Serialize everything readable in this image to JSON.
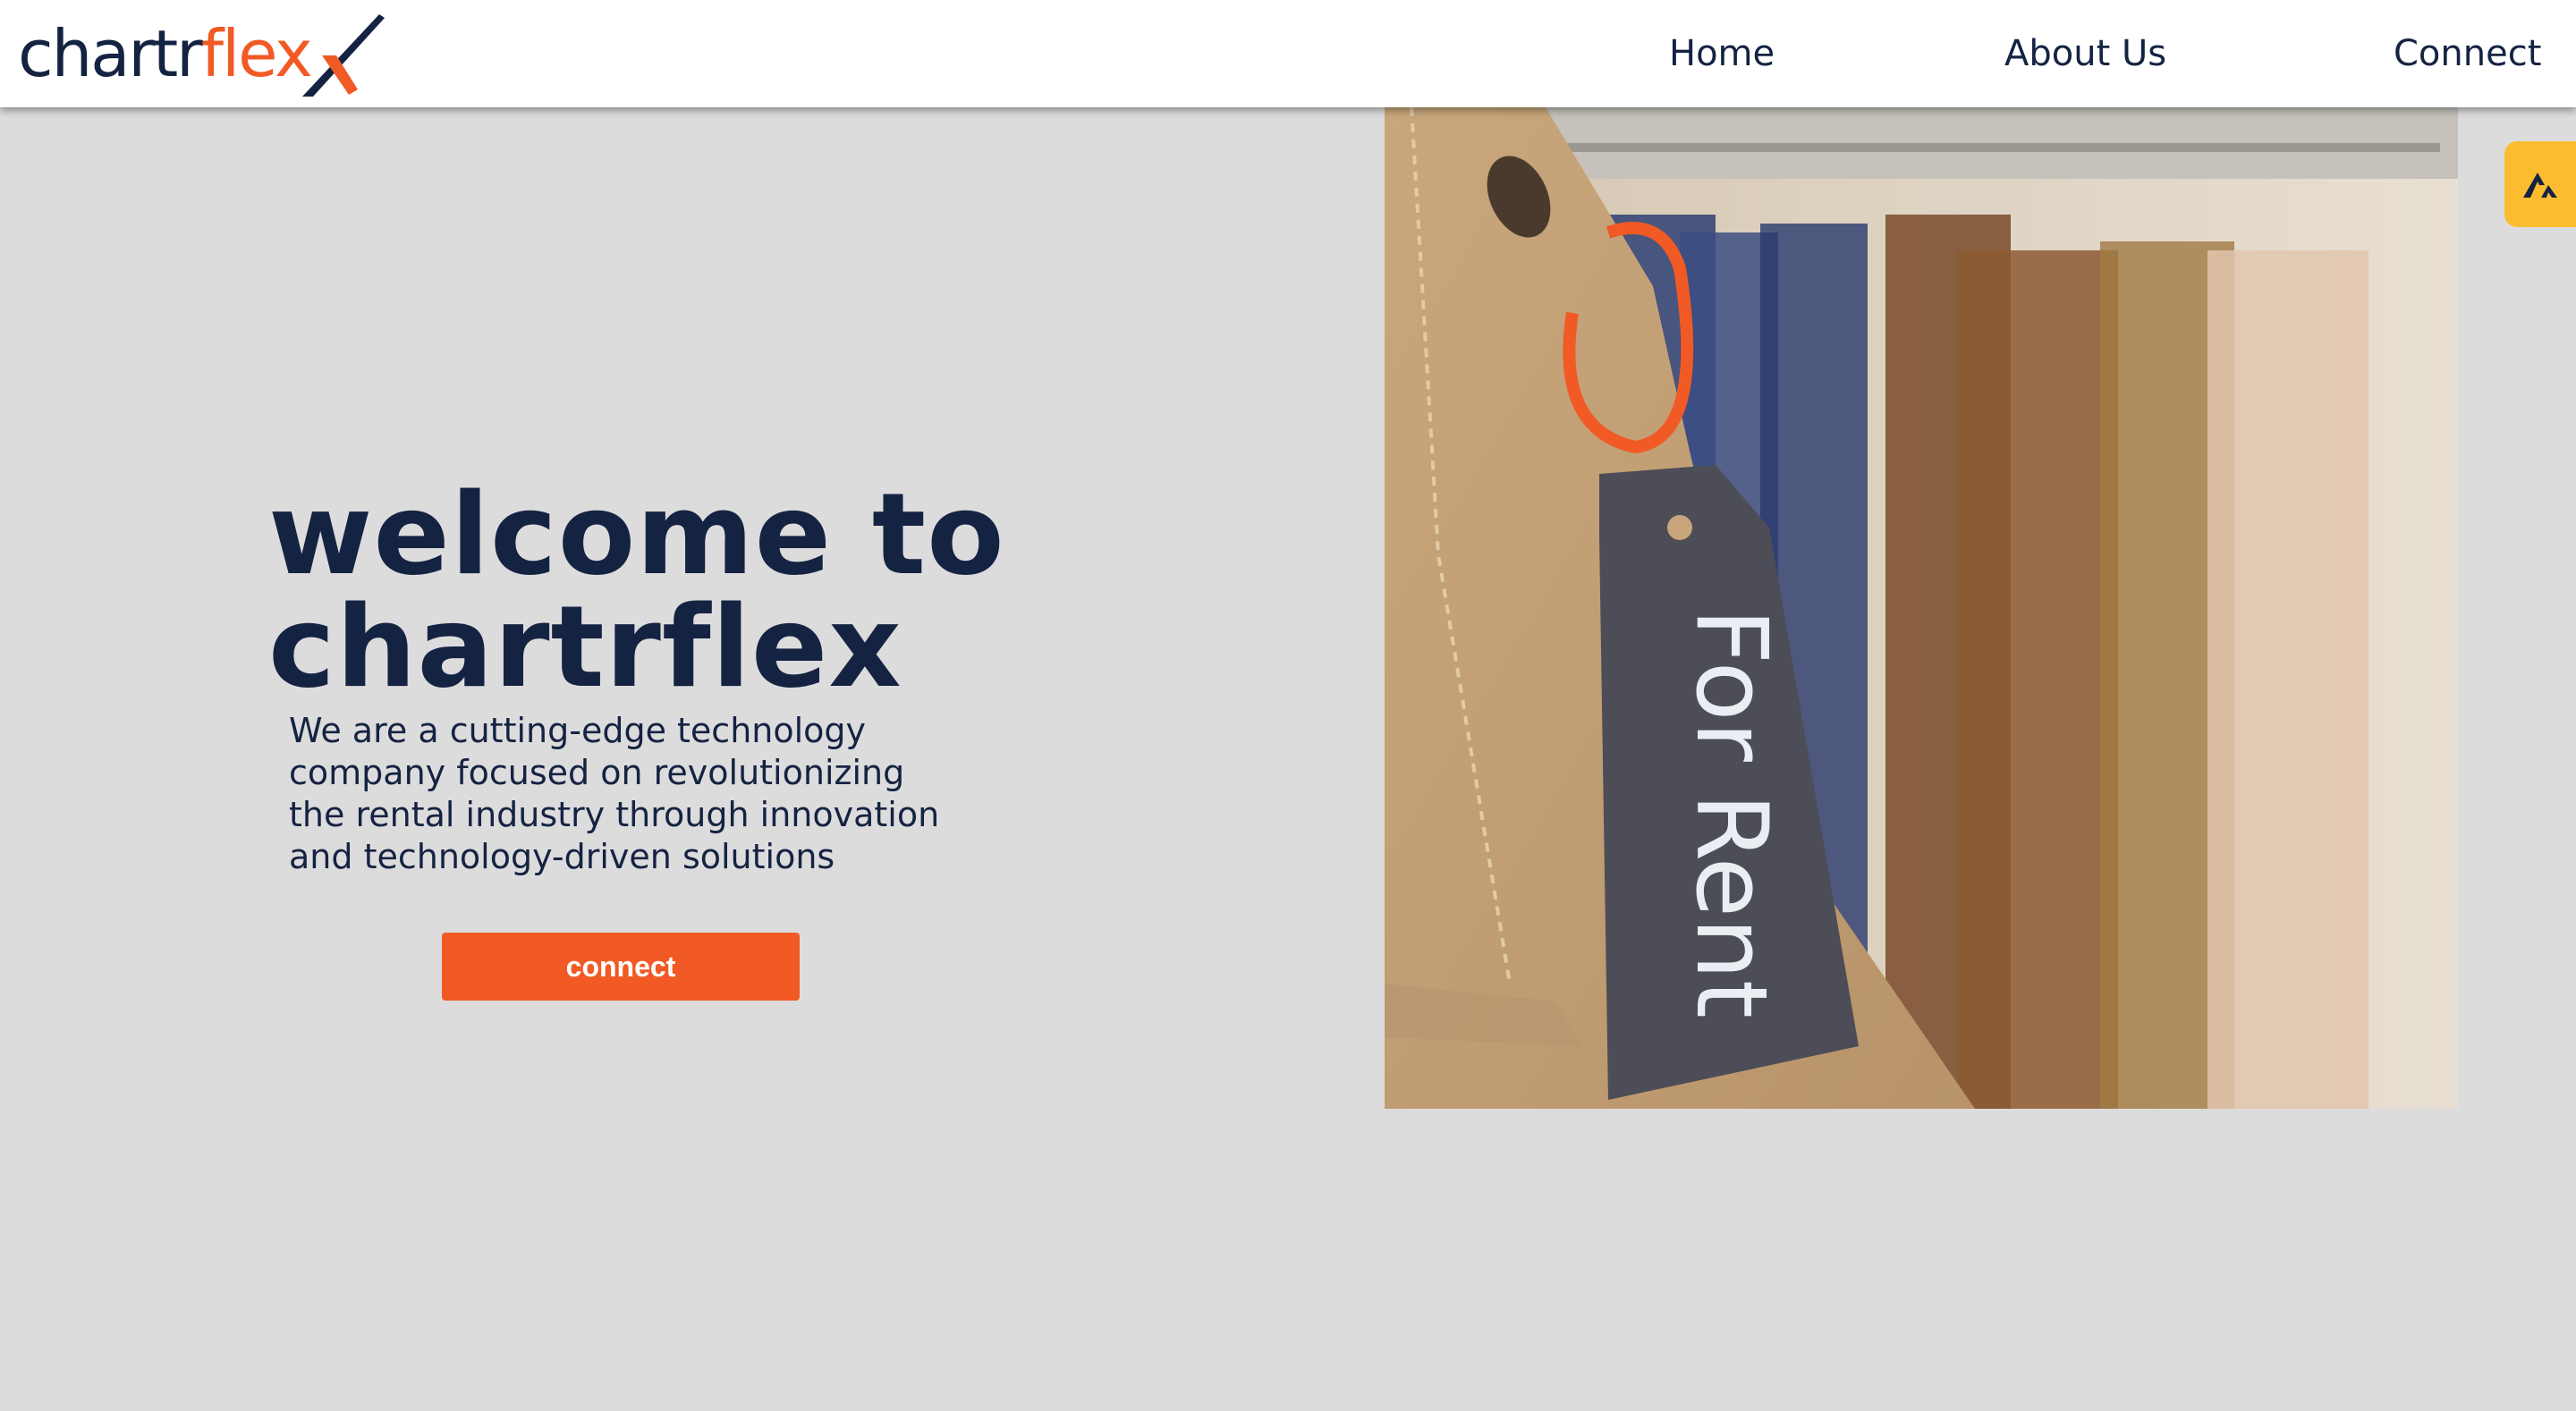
{
  "header": {
    "logo": {
      "part_dark": "chartr",
      "part_orange": "flex"
    },
    "nav": [
      {
        "label": "Home"
      },
      {
        "label": "About Us"
      },
      {
        "label": "Connect"
      }
    ]
  },
  "hero": {
    "title_line1": "welcome to",
    "title_line2": "chartrflex",
    "description_lines": [
      "We are a cutting-edge technology",
      "company focused on revolutionizing",
      "the rental industry through innovation",
      "and technology-driven solutions"
    ],
    "cta_label": "connect",
    "image": {
      "tag_text": "For Rent"
    }
  },
  "widget": {
    "icon": "arrow-logo-icon"
  },
  "colors": {
    "navy": "#152342",
    "orange": "#f15a24",
    "background": "#dddcdd",
    "widget": "#fbbd2f"
  }
}
